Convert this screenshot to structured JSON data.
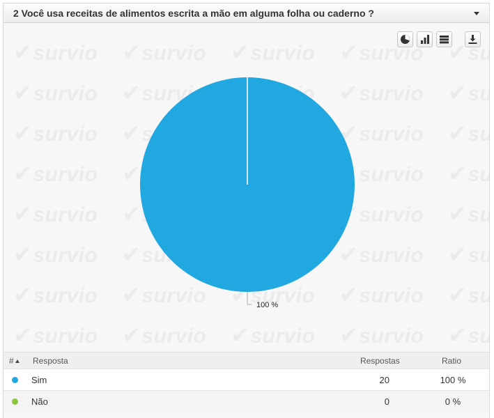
{
  "question": {
    "title": "2 Você usa receitas de alimentos escrita a mão em alguma folha ou caderno ?"
  },
  "watermark": {
    "text": "survio"
  },
  "toolbar": {
    "buttons": [
      "pie-chart-icon",
      "bar-chart-icon",
      "table-view-icon",
      "download-icon"
    ]
  },
  "colors": {
    "series": [
      "#22a8e0",
      "#8cc63f"
    ],
    "accent": "#22a8e0"
  },
  "chart_data": {
    "type": "pie",
    "categories": [
      "Sim",
      "Não"
    ],
    "values": [
      100,
      0
    ],
    "labels": [
      "100 %"
    ]
  },
  "table": {
    "headers": {
      "hash": "#",
      "answer": "Resposta",
      "count": "Respostas",
      "ratio": "Ratio"
    },
    "rows": [
      {
        "label": "Sim",
        "count": "20",
        "ratio": "100 %"
      },
      {
        "label": "Não",
        "count": "0",
        "ratio": "0 %"
      }
    ]
  }
}
